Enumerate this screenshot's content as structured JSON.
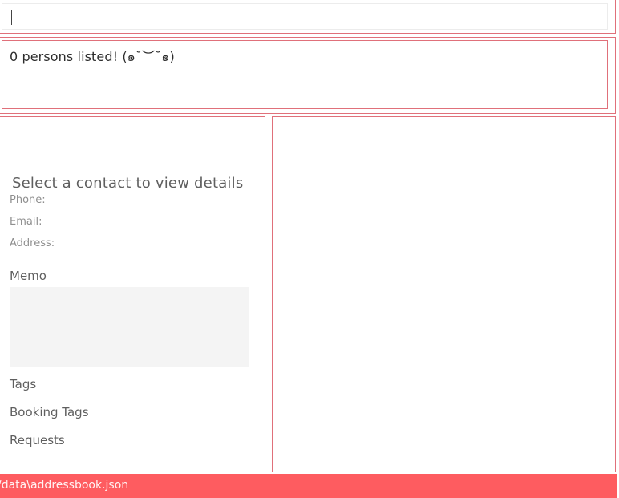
{
  "command_box": {
    "value": ""
  },
  "result_display": {
    "text": "0 persons listed! (๑˘︶˘๑)"
  },
  "detail_panel": {
    "title": "Select a contact to view details",
    "phone_label": "Phone:",
    "email_label": "Email:",
    "address_label": "Address:",
    "memo_label": "Memo",
    "memo_value": "",
    "tags_label": "Tags",
    "booking_tags_label": "Booking Tags",
    "requests_label": "Requests"
  },
  "status_bar": {
    "file_path": "/data\\addressbook.json"
  },
  "colors": {
    "border": "#e0707a",
    "status_bar": "#fe5c60",
    "memo_background": "#f4f4f4"
  }
}
